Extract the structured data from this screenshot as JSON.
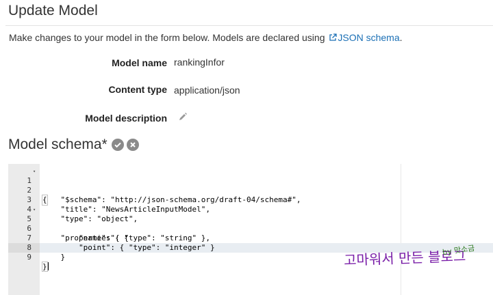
{
  "header": {
    "title": "Update Model",
    "intro_text": "Make changes to your model in the form below. Models are declared using ",
    "intro_link": "JSON schema",
    "intro_suffix": "."
  },
  "form": {
    "model_name_label": "Model name",
    "model_name_value": "rankingInfor",
    "content_type_label": "Content type",
    "content_type_value": "application/json",
    "model_description_label": "Model description"
  },
  "schema": {
    "title": "Model schema*"
  },
  "editor": {
    "lines": [
      {
        "num": "1",
        "fold": "▾",
        "text": "{"
      },
      {
        "num": "2",
        "fold": "",
        "text": "    \"$schema\": \"http://json-schema.org/draft-04/schema#\","
      },
      {
        "num": "3",
        "fold": "",
        "text": "    \"title\": \"NewsArticleInputModel\","
      },
      {
        "num": "4",
        "fold": "",
        "text": "    \"type\": \"object\","
      },
      {
        "num": "5",
        "fold": "▾",
        "text": "    \"properties\": {"
      },
      {
        "num": "6",
        "fold": "",
        "text": "        \"name\": { \"type\": \"string\" },"
      },
      {
        "num": "7",
        "fold": "",
        "text": "        \"point\": { \"type\": \"integer\" }"
      },
      {
        "num": "8",
        "fold": "",
        "text": "    }"
      },
      {
        "num": "9",
        "fold": "",
        "text": "}"
      }
    ]
  },
  "watermark": {
    "main": "고마워서 만든 블로그",
    "by": "by 맛소금"
  },
  "colors": {
    "link": "#1a6fb5",
    "watermark": "#7a1fa8",
    "gutter": "#ebebeb"
  }
}
